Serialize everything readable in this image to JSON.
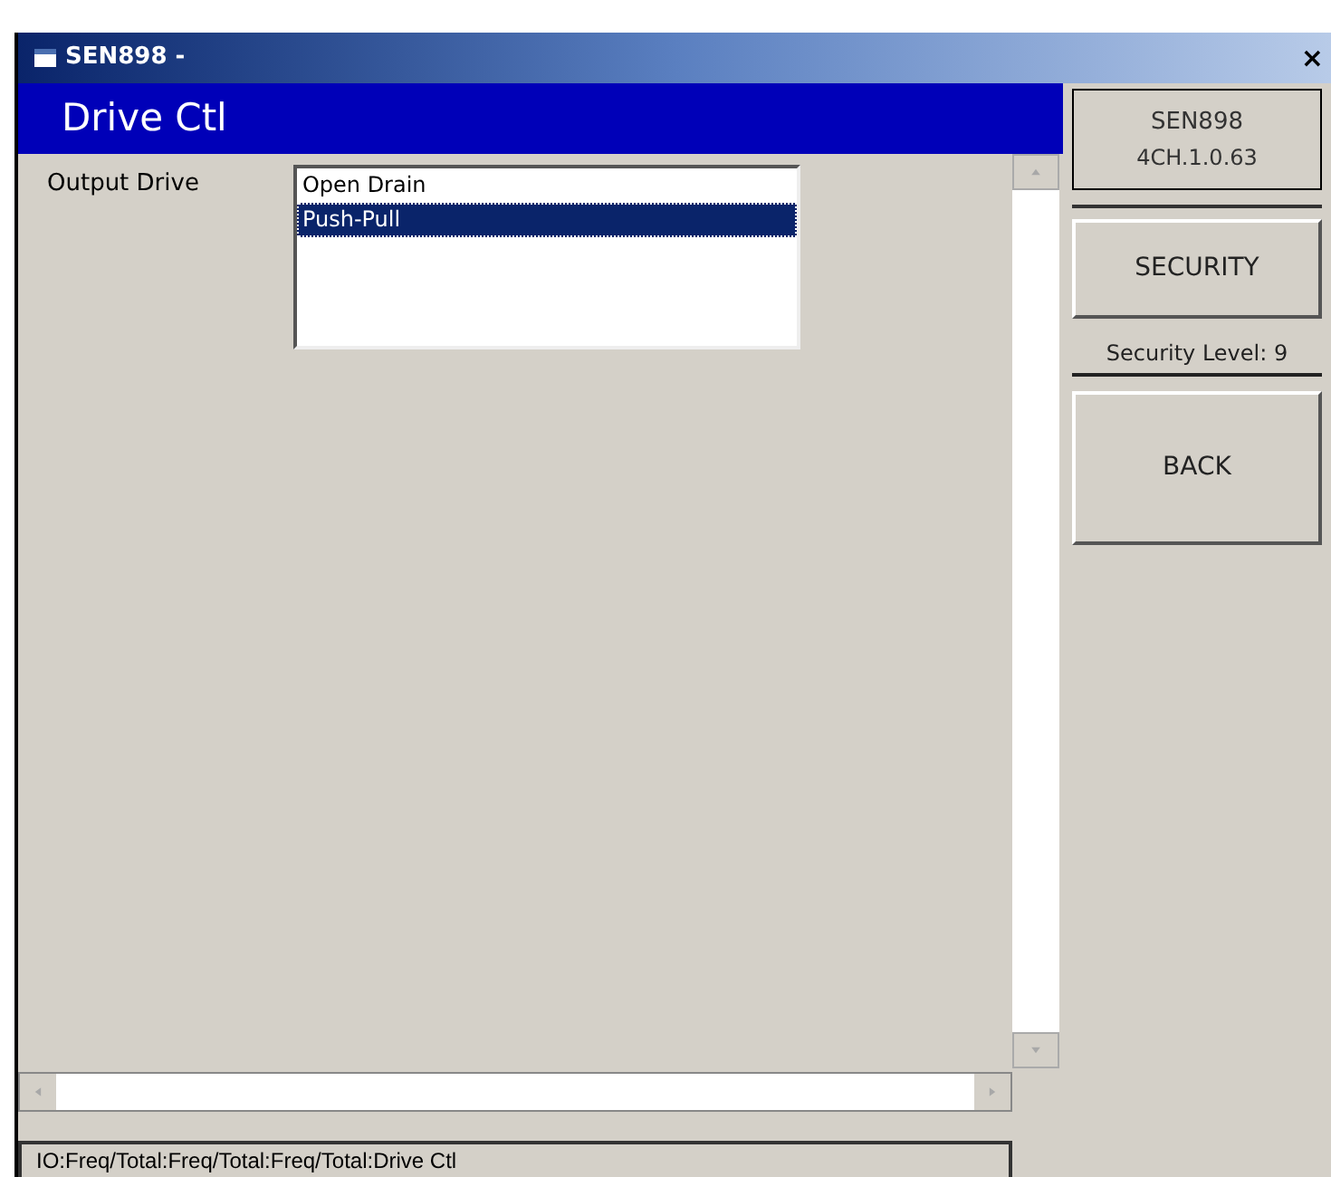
{
  "window": {
    "title": "SEN898 -",
    "close": "×"
  },
  "header": {
    "title": "Drive Ctl"
  },
  "device": {
    "name": "SEN898",
    "version": "4CH.1.0.63"
  },
  "field": {
    "label": "Output Drive",
    "options": [
      {
        "label": "Open Drain",
        "selected": false
      },
      {
        "label": "Push-Pull",
        "selected": true
      }
    ]
  },
  "side": {
    "security_button": "SECURITY",
    "security_level": "Security Level: 9",
    "back_button": "BACK"
  },
  "status_bar": {
    "path": "IO:Freq/Total:Freq/Total:Freq/Total:Drive Ctl"
  }
}
